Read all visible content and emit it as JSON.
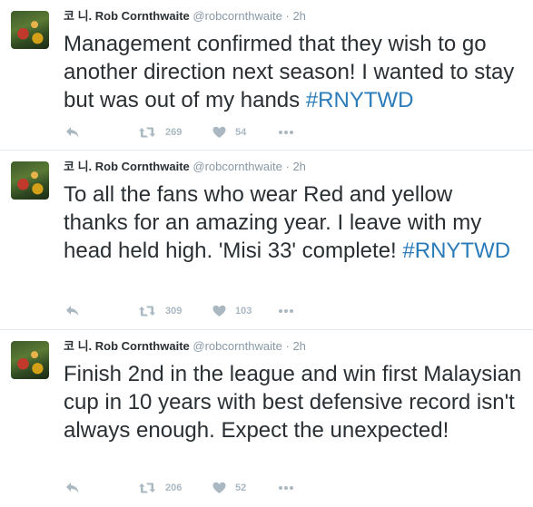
{
  "tweets": [
    {
      "name": "코 니. Rob Cornthwaite",
      "handle": "@robcornthwaite",
      "dot": "·",
      "time": "2h",
      "text": "Management confirmed that they wish to go another direction next season! I wanted to stay but was out of my hands ",
      "hashtag": "#RNYTWD",
      "retweets": "269",
      "likes": "54",
      "icons": [
        "reply-icon",
        "retweet-icon",
        "heart-icon",
        "more-icon"
      ]
    },
    {
      "name": "코 니. Rob Cornthwaite",
      "handle": "@robcornthwaite",
      "dot": "·",
      "time": "2h",
      "text": "To all the fans who wear Red and yellow thanks for an amazing year. I leave with my head held high. 'Misi 33' complete! ",
      "hashtag": "#RNYTWD",
      "retweets": "309",
      "likes": "103",
      "icons": [
        "reply-icon",
        "retweet-icon",
        "heart-icon",
        "more-icon"
      ]
    },
    {
      "name": "코 니. Rob Cornthwaite",
      "handle": "@robcornthwaite",
      "dot": "·",
      "time": "2h",
      "text": "Finish 2nd in the league and win first Malaysian cup in 10 years with best defensive record isn't always enough. Expect the unexpected!",
      "hashtag": "",
      "retweets": "206",
      "likes": "52",
      "icons": [
        "reply-icon",
        "retweet-icon",
        "heart-icon",
        "more-icon"
      ]
    }
  ],
  "colors": {
    "text": "#292f33",
    "muted": "#8899a6",
    "hashtag": "#2b7bb9",
    "icon": "#aab8c2",
    "divider": "#e1e8ed"
  }
}
